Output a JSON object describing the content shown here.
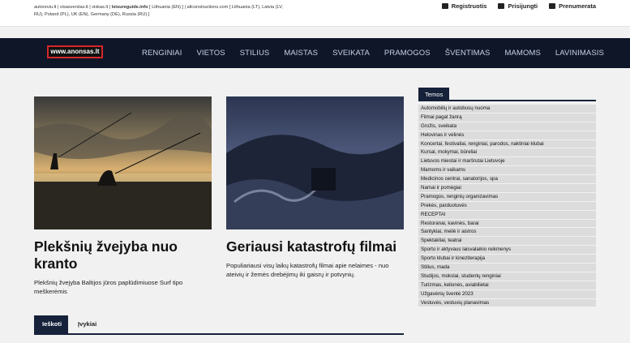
{
  "top_links": {
    "line1_a": "autoreviu.lt | visasverslas.lt | viskas.lt | ",
    "line1_b": "leisureguide.info",
    "line1_c": " [ Lithuania (EN) ] | allconstructions.com [ Lithuania (LT), Latvia (LV,",
    "line2": "RU), Poland (PL), UK (EN), Germany (DE), Russia (RU) ]"
  },
  "user_actions": [
    {
      "label": "Registruotis",
      "icon": "user-plus-icon"
    },
    {
      "label": "Prisijungti",
      "icon": "user-icon"
    },
    {
      "label": "Prenumerata",
      "icon": "newsletter-icon"
    }
  ],
  "logo_text": "www.anonsas.lt",
  "nav": [
    "RENGINIAI",
    "VIETOS",
    "STILIUS",
    "MAISTAS",
    "SVEIKATA",
    "PRAMOGOS",
    "ŠVENTIMAS",
    "MAMOMS",
    "LAVINIMASIS"
  ],
  "articles": [
    {
      "title": "Plekšnių žvejyba nuo kranto",
      "excerpt": "Plekšnių žvejyba Baltijos jūros paplūdimiuose Surf tipo meškerėmis"
    },
    {
      "title": "Geriausi katastrofų filmai",
      "excerpt": "Populiariausi visų laikų katastrofų filmai apie nelaimes - nuo ateivių ir žemės drebėjimų iki gaisrų ir potvynių."
    }
  ],
  "tabs": [
    "Ieškoti",
    "Įvykiai"
  ],
  "sidebar": {
    "title": "Temos",
    "items": [
      "Automobilių ir autobusų nuoma",
      "Filmai pagal žanrą",
      "Grožis, sveikata",
      "Helovinas ir vėlinės",
      "Koncertai, festivaliai, renginiai, parodos, naktiniai klubai",
      "Kursai, mokymai, būreliai",
      "Lietuvos miestai ir maršrutai Lietuvoje",
      "Mamoms ir vaikams",
      "Medicinos centrai, sanatorijos, spa",
      "Namai ir pomėgiai",
      "Pramogos, renginių organizavimas",
      "Prekės, parduotuvės",
      "RECEPTAI",
      "Restoranai, kavinės, barai",
      "Santykiai, meilė ir aistros",
      "Spektakliai, teatrai",
      "Sporto ir aktyvaus laisvalaikio reikmenys",
      "Sporto klubai ir kineziterapija",
      "Stilius, mada",
      "Studijos, mokslai, studentų renginiai",
      "Turizmas, kelionės, aviabilietai",
      "Užgavėnių šventė 2023",
      "Vestuvės, vestuvių planavimas"
    ]
  }
}
